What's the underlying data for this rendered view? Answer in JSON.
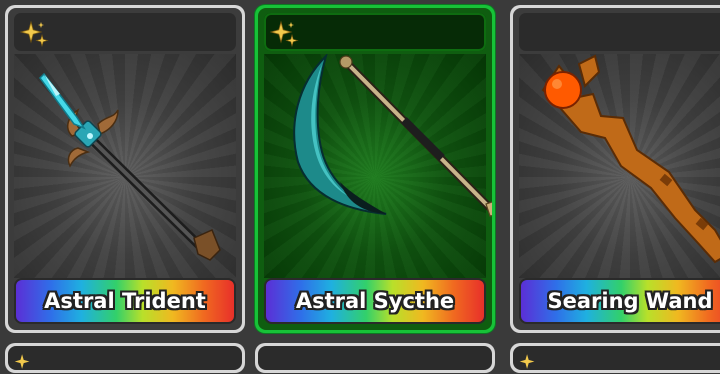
{
  "cards": [
    {
      "name": "Astral Trident",
      "weapon_icon": "trident-icon",
      "rarity_icon": "sparkle-icon",
      "selected": false
    },
    {
      "name": "Astral Sycthe",
      "weapon_icon": "scythe-icon",
      "rarity_icon": "sparkle-icon",
      "selected": true
    },
    {
      "name": "Searing Wand",
      "weapon_icon": "wand-icon",
      "rarity_icon": "sparkle-icon",
      "selected": false
    }
  ],
  "colors": {
    "card_border": "#d7d7d7",
    "selected_border": "#17c238",
    "sparkle": "#f2c94c"
  }
}
